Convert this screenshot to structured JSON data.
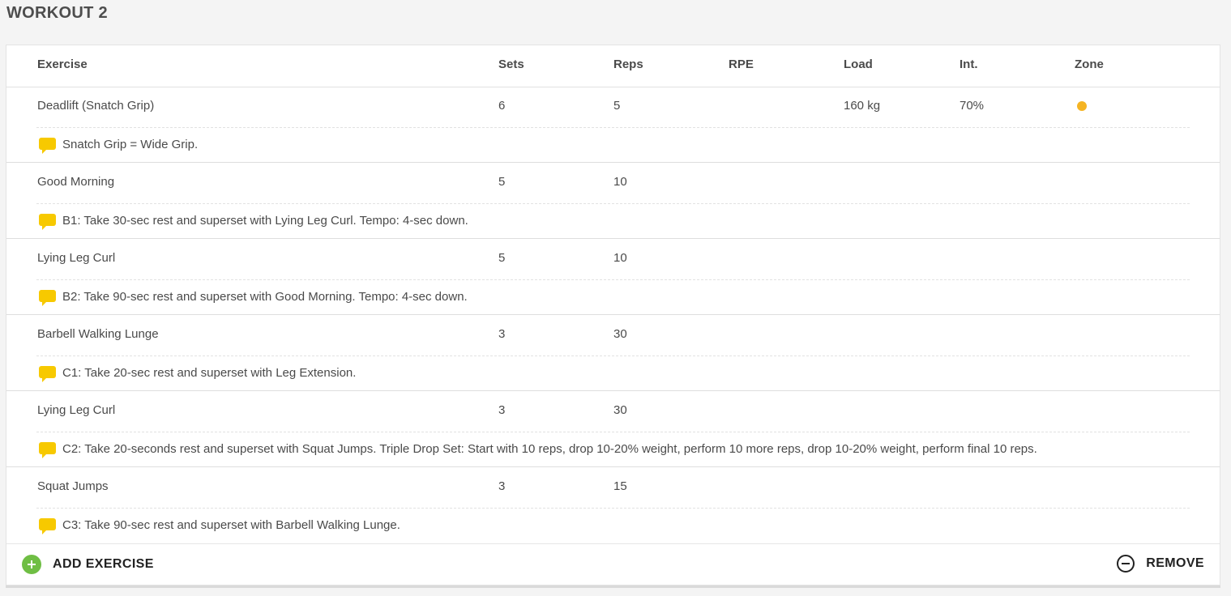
{
  "page": {
    "title": "WORKOUT 2"
  },
  "table": {
    "headers": {
      "exercise": "Exercise",
      "sets": "Sets",
      "reps": "Reps",
      "rpe": "RPE",
      "load": "Load",
      "int": "Int.",
      "zone": "Zone"
    },
    "rows": [
      {
        "exercise": "Deadlift (Snatch Grip)",
        "sets": "6",
        "reps": "5",
        "rpe": "",
        "load": "160 kg",
        "int": "70%",
        "zone_color": "#f5b423",
        "note": "Snatch Grip = Wide Grip."
      },
      {
        "exercise": "Good Morning",
        "sets": "5",
        "reps": "10",
        "rpe": "",
        "load": "",
        "int": "",
        "note": "B1: Take 30-sec rest and superset with Lying Leg Curl. Tempo: 4-sec down."
      },
      {
        "exercise": "Lying Leg Curl",
        "sets": "5",
        "reps": "10",
        "rpe": "",
        "load": "",
        "int": "",
        "note": "B2: Take 90-sec rest and superset with Good Morning. Tempo: 4-sec down."
      },
      {
        "exercise": "Barbell Walking Lunge",
        "sets": "3",
        "reps": "30",
        "rpe": "",
        "load": "",
        "int": "",
        "note": "C1: Take 20-sec rest and superset with Leg Extension."
      },
      {
        "exercise": "Lying Leg Curl",
        "sets": "3",
        "reps": "30",
        "rpe": "",
        "load": "",
        "int": "",
        "note": "C2: Take 20-seconds rest and superset with Squat Jumps. Triple Drop Set: Start with 10 reps, drop 10-20% weight, perform 10 more reps, drop 10-20% weight, perform final 10 reps."
      },
      {
        "exercise": "Squat Jumps",
        "sets": "3",
        "reps": "15",
        "rpe": "",
        "load": "",
        "int": "",
        "note": "C3: Take 90-sec rest and superset with Barbell Walking Lunge."
      }
    ]
  },
  "footer": {
    "add_label": "ADD EXERCISE",
    "remove_label": "REMOVE"
  },
  "icons": {
    "note": "speech-bubble-icon",
    "add": "plus-circle-icon",
    "remove": "minus-circle-icon"
  },
  "colors": {
    "note_icon": "#f7c900",
    "add_icon": "#6fbe44"
  }
}
